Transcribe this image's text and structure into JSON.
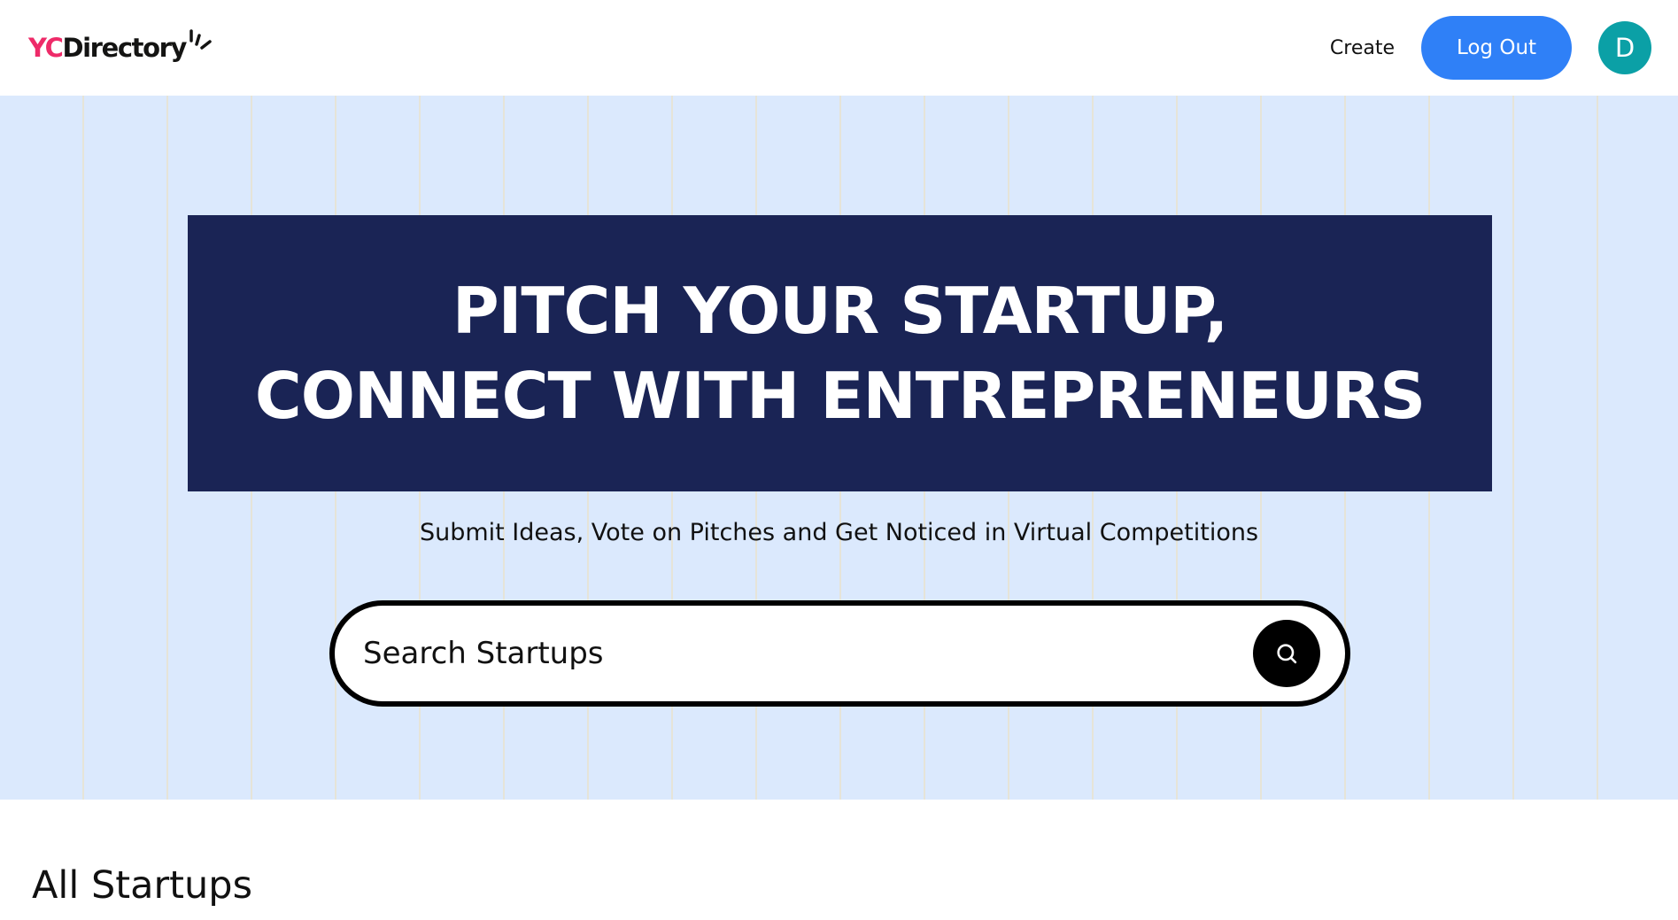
{
  "header": {
    "logo": {
      "part1": "YC",
      "part2": "Directory",
      "accent_color": "#ee2b69"
    },
    "nav": {
      "create_label": "Create",
      "logout_label": "Log Out",
      "avatar_initial": "D",
      "logout_color": "#2f80f7",
      "avatar_color": "#0ba0a6"
    }
  },
  "hero": {
    "headline_line1": "PITCH YOUR STARTUP,",
    "headline_line2": "CONNECT WITH ENTREPRENEURS",
    "subheading": "Submit Ideas, Vote on Pitches and Get Noticed in Virtual Competitions",
    "search": {
      "placeholder": "Search Startups",
      "value": "",
      "button_icon": "search-icon"
    },
    "colors": {
      "background": "#dbe9fd",
      "headline_box": "#1a2455"
    }
  },
  "main": {
    "section_title": "All Startups"
  }
}
